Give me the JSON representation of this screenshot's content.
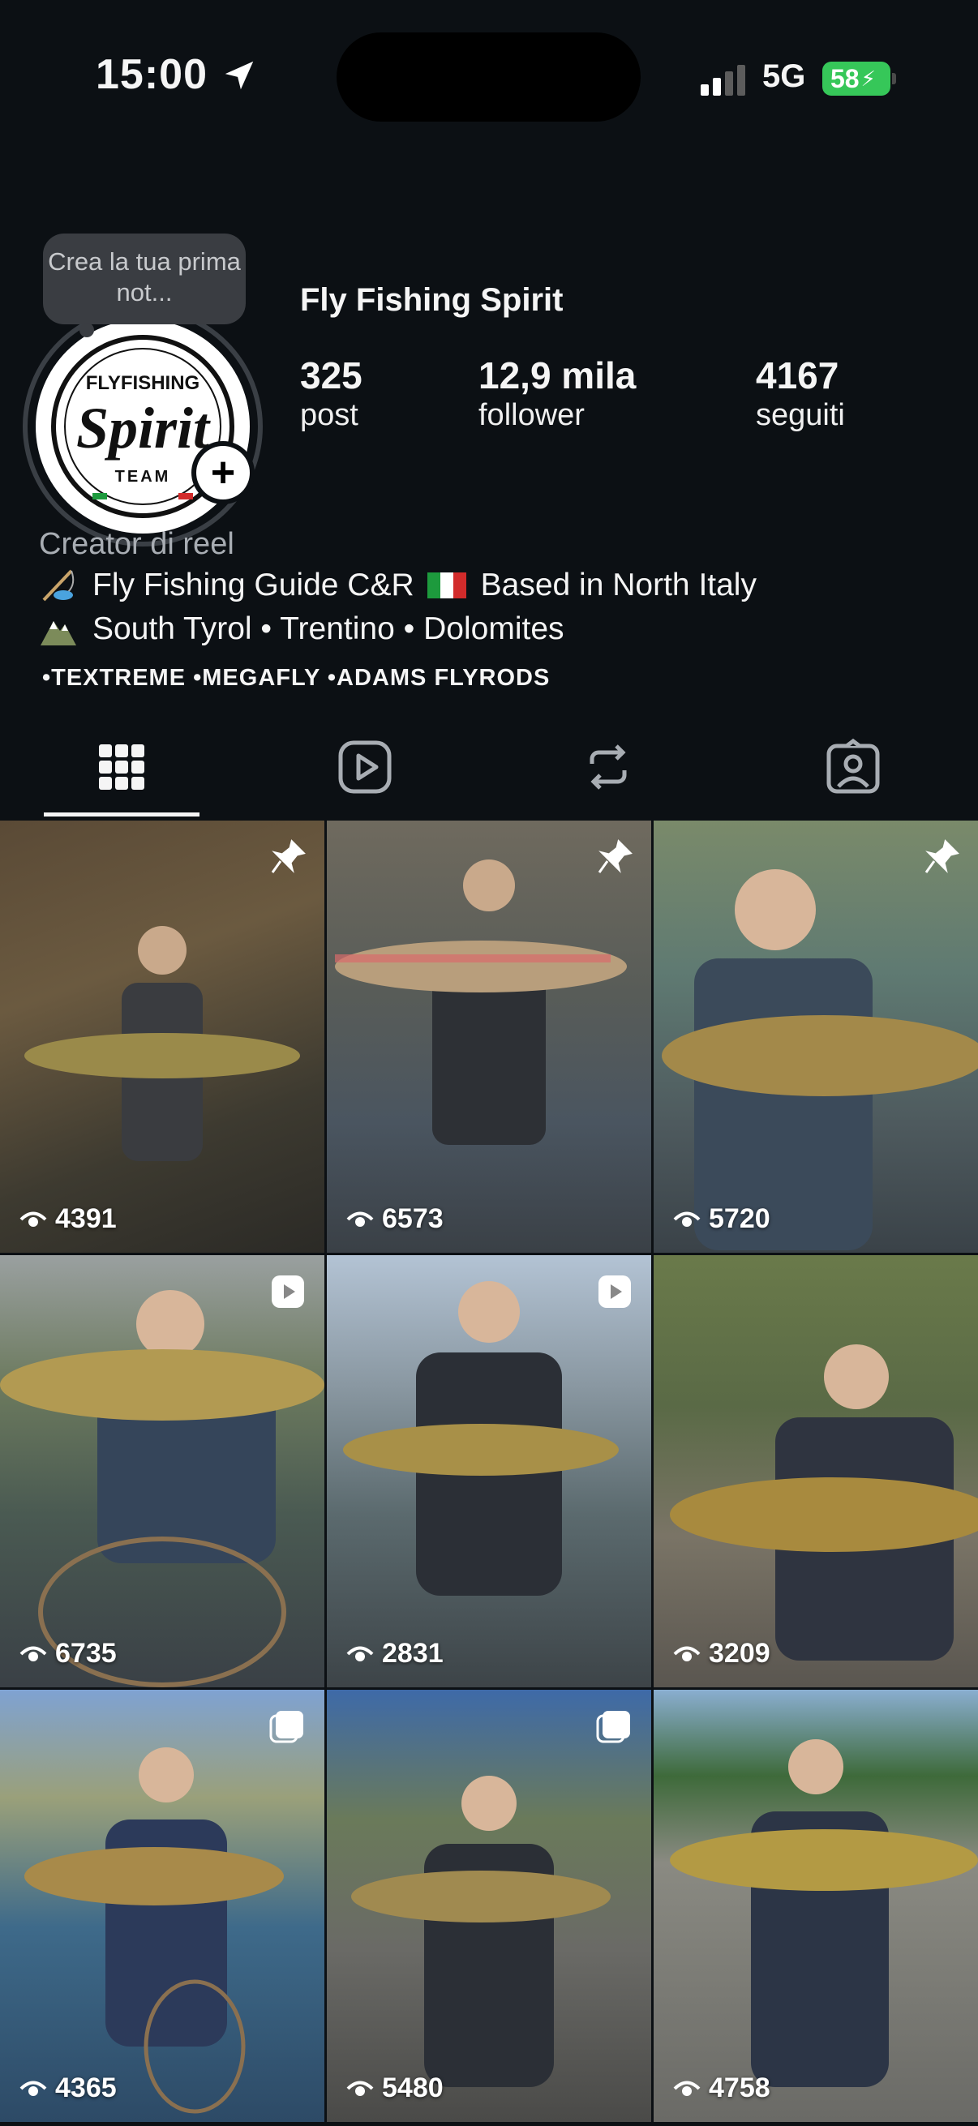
{
  "status_bar": {
    "time": "15:00",
    "network": "5G",
    "battery": "58"
  },
  "profile": {
    "note_bubble": "Crea la tua prima not...",
    "avatar_text_top": "FLYFISHING",
    "avatar_text_main": "Spirit",
    "avatar_text_bottom": "TEAM",
    "username": "Fly Fishing Spirit",
    "stats": [
      {
        "value": "325",
        "label": "post"
      },
      {
        "value": "12,9 mila",
        "label": "follower"
      },
      {
        "value": "4167",
        "label": "seguiti"
      }
    ],
    "category": "Creator di reel",
    "bio_line1_a": "Fly Fishing Guide C&R",
    "bio_line1_b": "Based in North Italy",
    "bio_line2": "South Tyrol • Trentino • Dolomites",
    "bio_line3": "•TEXTREME •MEGAFLY •ADAMS FLYRODS"
  },
  "tabs": [
    {
      "icon": "grid-icon",
      "active": true
    },
    {
      "icon": "reels-icon",
      "active": false
    },
    {
      "icon": "reposts-icon",
      "active": false
    },
    {
      "icon": "tagged-icon",
      "active": false
    }
  ],
  "posts": [
    {
      "views": "4391",
      "badge": "pin-icon"
    },
    {
      "views": "6573",
      "badge": "pin-icon"
    },
    {
      "views": "5720",
      "badge": "pin-icon"
    },
    {
      "views": "6735",
      "badge": "reel-icon"
    },
    {
      "views": "2831",
      "badge": "reel-icon"
    },
    {
      "views": "3209",
      "badge": ""
    },
    {
      "views": "4365",
      "badge": "carousel-icon"
    },
    {
      "views": "5480",
      "badge": "carousel-icon"
    },
    {
      "views": "4758",
      "badge": ""
    }
  ],
  "colors": {
    "background": "#0c1014",
    "battery": "#36c759",
    "muted_text": "#a8adb3"
  }
}
